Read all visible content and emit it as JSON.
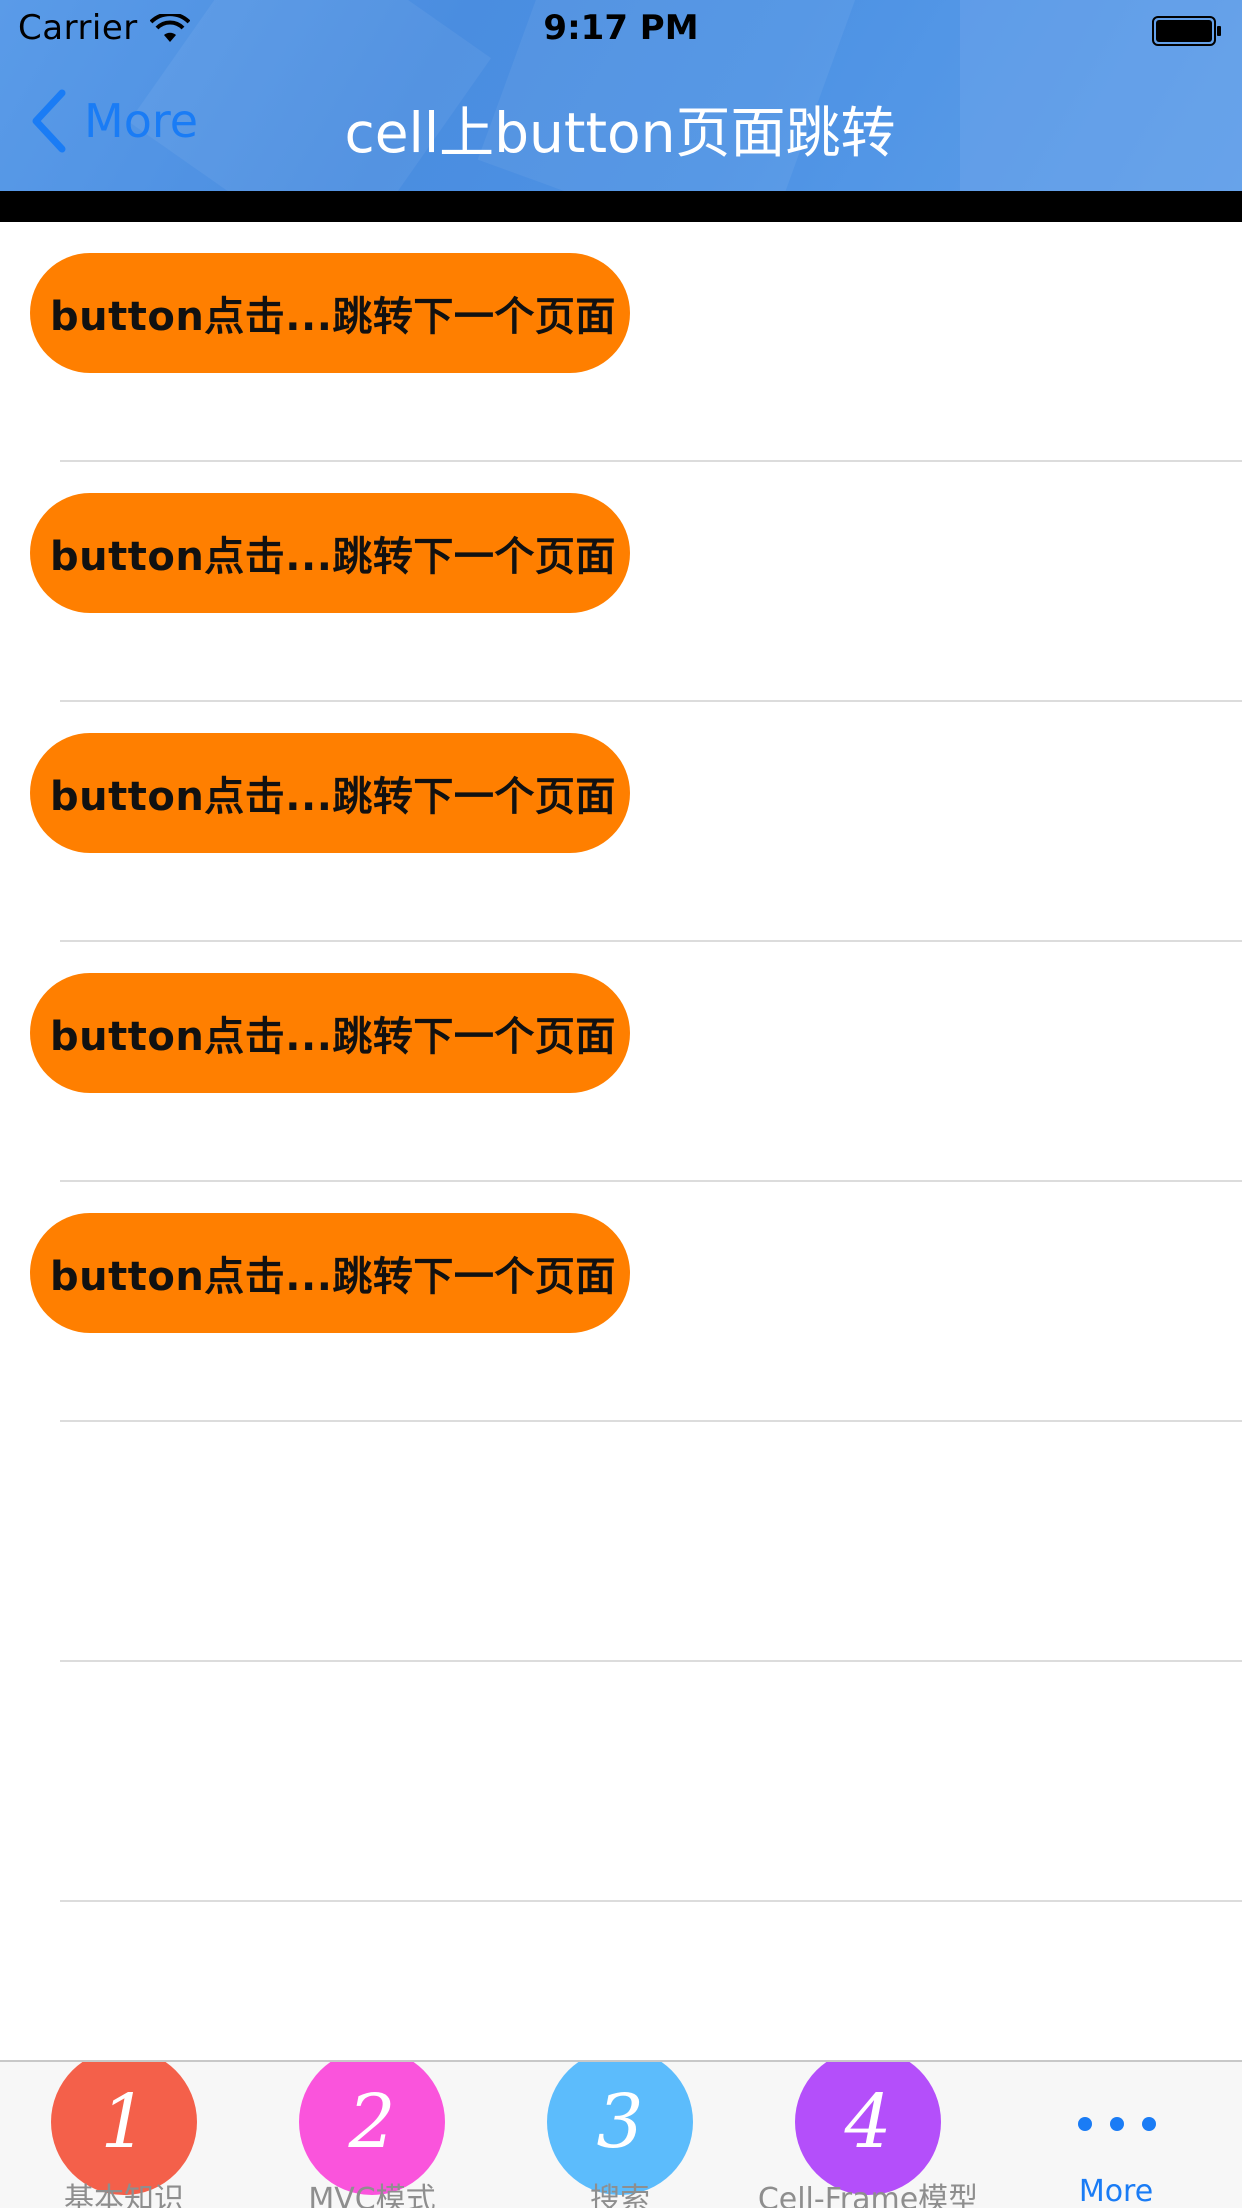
{
  "status_bar": {
    "carrier": "Carrier",
    "time": "9:17 PM",
    "wifi_icon": "wifi-icon",
    "battery_icon": "battery-icon"
  },
  "nav": {
    "back_label": "More",
    "back_icon": "chevron-left-icon",
    "title": "cell上button页面跳转"
  },
  "list": {
    "buttons": [
      "button点击...跳转下一个页面",
      "button点击...跳转下一个页面",
      "button点击...跳转下一个页面",
      "button点击...跳转下一个页面",
      "button点击...跳转下一个页面"
    ],
    "empty_rows": 3
  },
  "tabbar": {
    "items": [
      {
        "badge": "1",
        "label": "基本知识",
        "color": "#f4604a"
      },
      {
        "badge": "2",
        "label": "MVC模式",
        "color": "#fa54dc"
      },
      {
        "badge": "3",
        "label": "搜索",
        "color": "#5cbcfc"
      },
      {
        "badge": "4",
        "label": "Cell-Frame模型",
        "color": "#b44ffa"
      },
      {
        "label": "More",
        "icon": "more-dots-icon",
        "selected": true
      }
    ]
  },
  "colors": {
    "accent": "#1a7cf5",
    "button_orange": "#ff7f00",
    "header_blue": "#4a8de0"
  }
}
